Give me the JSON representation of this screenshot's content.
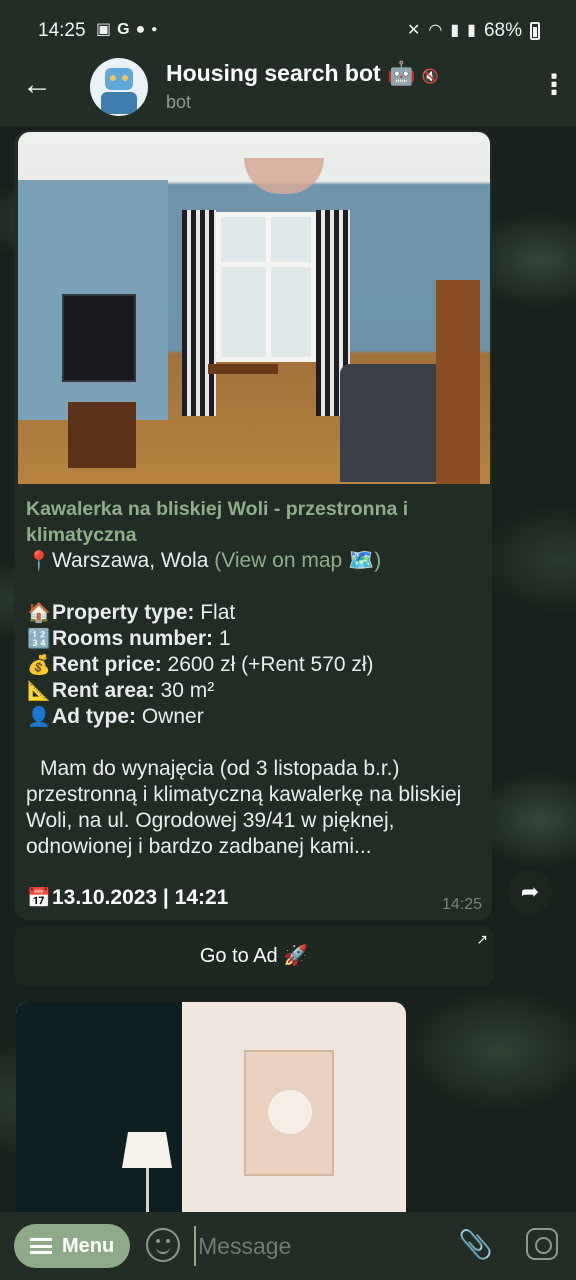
{
  "status_bar": {
    "time": "14:25",
    "left_icons": [
      "gallery-icon",
      "google-icon",
      "chat-icon",
      "dot-icon"
    ],
    "right_icons": [
      "mute-vibrate-icon",
      "wifi-icon",
      "signal-icon",
      "signal-icon"
    ],
    "battery": "68%"
  },
  "header": {
    "title": "Housing search bot 🤖",
    "subtitle": "bot"
  },
  "message": {
    "title": "Kawalerka na bliskiej Woli - przestronna i klimatyczna",
    "location_text": "Warszawa, Wola",
    "location_link": "(View on map 🗺️)",
    "props": [
      {
        "emoji": "🏠",
        "label": "Property type:",
        "value": " Flat"
      },
      {
        "emoji": "🔢",
        "label": "Rooms number:",
        "value": " 1"
      },
      {
        "emoji": "💰",
        "label": "Rent price:",
        "value": " 2600 zł (+Rent 570 zł)"
      },
      {
        "emoji": "📐",
        "label": "Rent area:",
        "value": " 30 m²"
      },
      {
        "emoji": "👤",
        "label": "Ad type:",
        "value": " Owner"
      }
    ],
    "description": "Mam do wynajęcia (od 3 listopada b.r.) przestronną i klimatyczną kawalerkę na bliskiej Woli, na ul. Ogrodowej 39/41 w pięknej, odnowionej i bardzo zadbanej kami...",
    "date_emoji": "📅",
    "date": "13.10.2023 | 14:21",
    "time": "14:25"
  },
  "inline_button": {
    "label": "Go to Ad 🚀"
  },
  "input_bar": {
    "menu_label": "Menu",
    "placeholder": "Message"
  }
}
